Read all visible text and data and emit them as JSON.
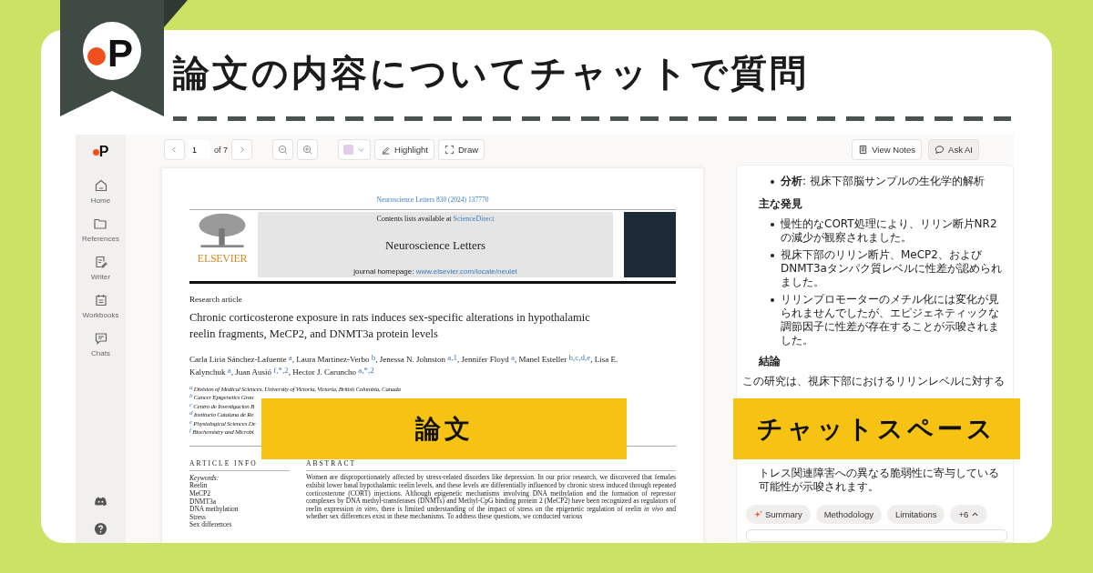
{
  "banner": {
    "logo": "P",
    "title": "論文の内容についてチャットで質問"
  },
  "labels": [
    {
      "kind": "paper",
      "text": "論文"
    },
    {
      "kind": "chat",
      "text": "チャットスペース"
    }
  ],
  "sidebar": {
    "logo": "P",
    "items": [
      {
        "kind": "home",
        "label": "Home"
      },
      {
        "kind": "folder",
        "label": "References"
      },
      {
        "kind": "writer",
        "label": "Writer"
      },
      {
        "kind": "workbook",
        "label": "Workbooks"
      },
      {
        "kind": "chat",
        "label": "Chats"
      }
    ]
  },
  "toolbar": {
    "page": "1",
    "page_count": "of 7",
    "tools": [
      {
        "kind": "highlight",
        "label": "Highlight"
      },
      {
        "kind": "draw",
        "label": "Draw"
      }
    ],
    "right": [
      {
        "kind": "notes",
        "label": "View Notes",
        "selected": false
      },
      {
        "kind": "ask",
        "label": "Ask AI",
        "selected": true
      }
    ]
  },
  "paper": {
    "citation": "Neuroscience Letters 830 (2024) 137770",
    "contents": "Contents lists available at",
    "contents_link": "ScienceDirect",
    "journal": "Neuroscience Letters",
    "homepage": "journal homepage:",
    "homepage_link": "www.elsevier.com/locate/neulet",
    "publisher": "ELSEVIER",
    "type": "Research article",
    "title": "Chronic corticosterone exposure in rats induces sex-specific alterations in hypothalamic reelin fragments, MeCP2, and DNMT3a protein levels",
    "authors": "Carla Liria Sánchez-Lafuente $^{a}$, Laura Martinez-Verbo $^{b}$, Jenessa N. Johnston $^{a,1}$, Jennifer Floyd $^{a}$, Manel Esteller $^{b,c,d,e}$, Lisa E. Kalynchuk $^{a}$, Juan Ausió $^{f,*,2}$, Hector J. Caruncho $^{a,*,2}$",
    "affiliations": [
      "$^{a}$ Division of Medical Sciences, University of Victoria, Victoria, British Columbia, Canada",
      "$^{b}$ Cancer Epigenetics Grou",
      "$^{c}$ Centro de Investigacion B",
      "$^{d}$ Institucio Catalana de Re",
      "$^{e}$ Physiological Sciences De",
      "$^{f}$ Biochemistry and Microbi"
    ],
    "info_heading": "ARTICLE INFO",
    "keywords_label": "Keywords:",
    "keywords": [
      "Reelin",
      "MeCP2",
      "DNMT3a",
      "DNA methylation",
      "Stress",
      "Sex differences"
    ],
    "abstract_heading": "ABSTRACT",
    "abstract": "Women are disproportionately affected by stress-related disorders like depression. In our prior research, we discovered that females exhibit lower basal hypothalamic reelin levels, and these levels are differentially influenced by chronic stress induced through repeated corticosterone (CORT) injections. Although epigenetic mechanisms involving DNA methylation and the formation of repressor complexes by DNA methyl-transferases (DNMTs) and Methyl-CpG binding protein 2 (MeCP2) have been recognized as regulators of reelin expression *in vitro*, there is limited understanding of the impact of stress on the epigenetic regulation of reelin *in vivo* and whether sex differences exist in these mechanisms. To address these questions, we conducted various"
  },
  "chat": {
    "blocks": [
      {
        "kind": "bullet",
        "text": "**分析**: 視床下部脳サンプルの生化学的解析"
      },
      {
        "kind": "heading",
        "text": "主な発見"
      },
      {
        "kind": "bullet",
        "text": "慢性的なCORT処理により、リリン断片NR2の減少が観察されました。"
      },
      {
        "kind": "bullet",
        "text": "視床下部のリリン断片、MeCP2、および DNMT3aタンパク質レベルに性差が認められました。"
      },
      {
        "kind": "bullet",
        "text": "リリンプロモーターのメチル化には変化が見られませんでしたが、エピジェネティックな調節因子に性差が存在することが示唆されました。"
      },
      {
        "kind": "heading",
        "text": "結論"
      },
      {
        "kind": "para",
        "text": "この研究は、視床下部におけるリリンレベルに対する"
      },
      {
        "kind": "continued",
        "text": "トレス関連障害への異なる脆弱性に寄与している可能性が示唆されます。"
      }
    ],
    "chips": [
      {
        "kind": "ai",
        "label": "Summary"
      },
      {
        "kind": "plain",
        "label": "Methodology"
      },
      {
        "kind": "plain",
        "label": "Limitations"
      },
      {
        "kind": "more",
        "label": "+6"
      }
    ]
  }
}
